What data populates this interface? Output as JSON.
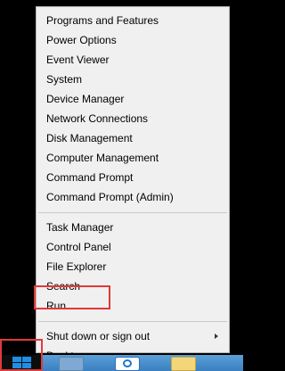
{
  "menu": {
    "group1": [
      "Programs and Features",
      "Power Options",
      "Event Viewer",
      "System",
      "Device Manager",
      "Network Connections",
      "Disk Management",
      "Computer Management",
      "Command Prompt",
      "Command Prompt (Admin)"
    ],
    "group2": [
      "Task Manager",
      "Control Panel",
      "File Explorer",
      "Search",
      "Run"
    ],
    "group3": [
      "Shut down or sign out",
      "Desktop"
    ]
  },
  "icons": {
    "start": "windows-logo-icon",
    "taskbar": [
      "file-manager-icon",
      "internet-explorer-icon",
      "folder-icon"
    ],
    "submenu": "chevron-right-icon"
  },
  "colors": {
    "highlight": "#e03a3a",
    "taskbar": "#3a7fc0",
    "menu_bg": "#f0f0f0"
  }
}
